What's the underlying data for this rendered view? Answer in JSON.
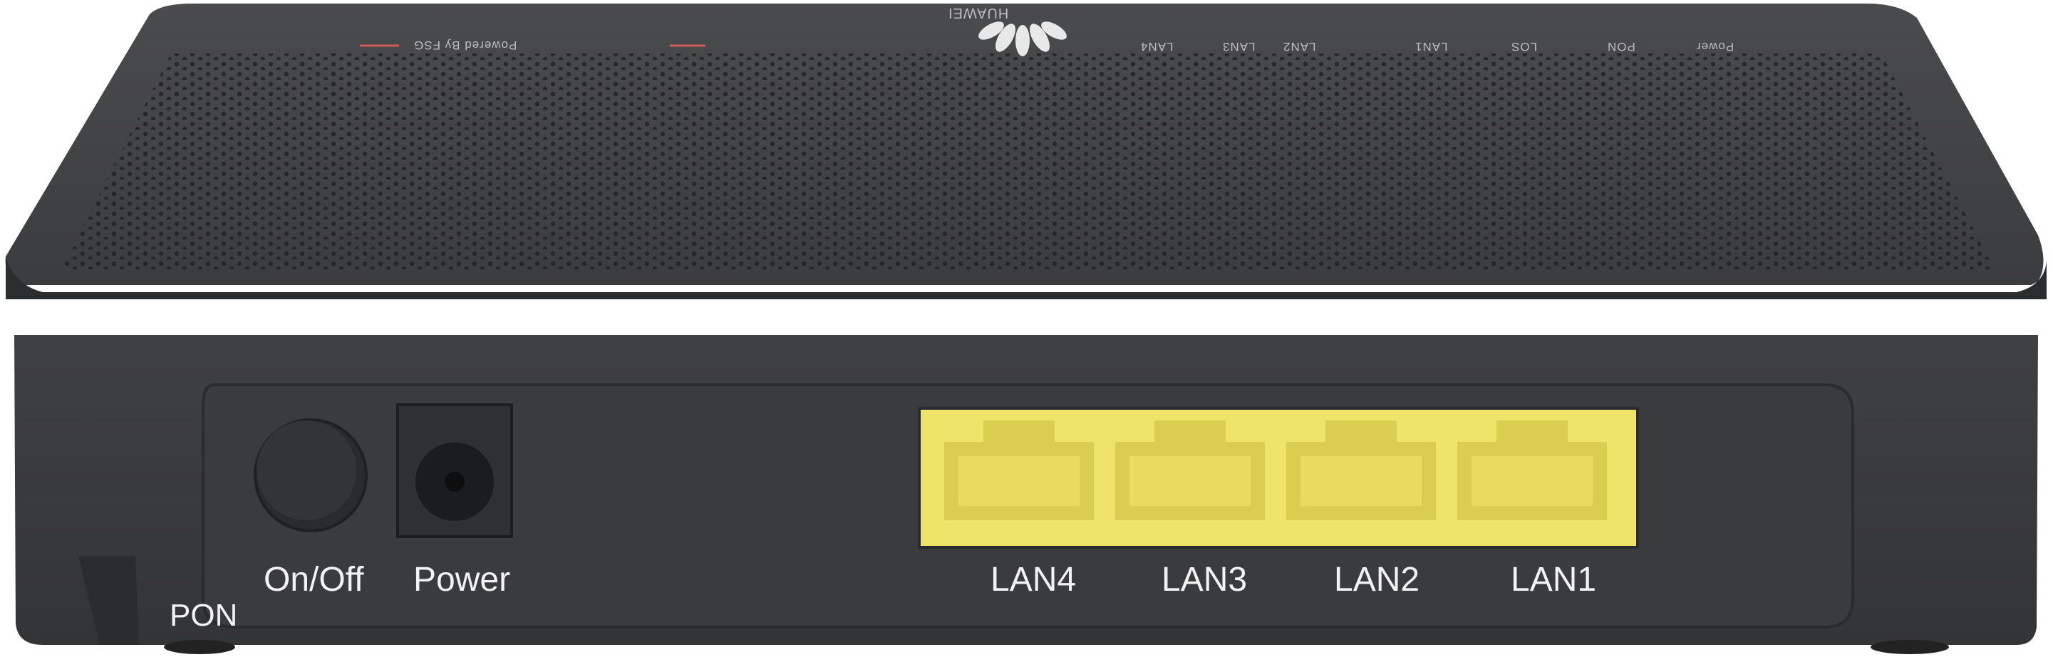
{
  "device": {
    "brand": "HUAWEI",
    "top_tagline": "Powered By FSG",
    "top_indicators": [
      "Power",
      "PON",
      "LOS",
      "LAN1",
      "LAN2",
      "LAN3",
      "LAN4"
    ],
    "rear_labels": {
      "pon": "PON",
      "on_off": "On/Off",
      "power": "Power",
      "lan4": "LAN4",
      "lan3": "LAN3",
      "lan2": "LAN2",
      "lan1": "LAN1"
    },
    "colors": {
      "body": "#3a3b3d",
      "lan_port": "#f2e86a",
      "accent_line": "#d05a5a"
    }
  }
}
